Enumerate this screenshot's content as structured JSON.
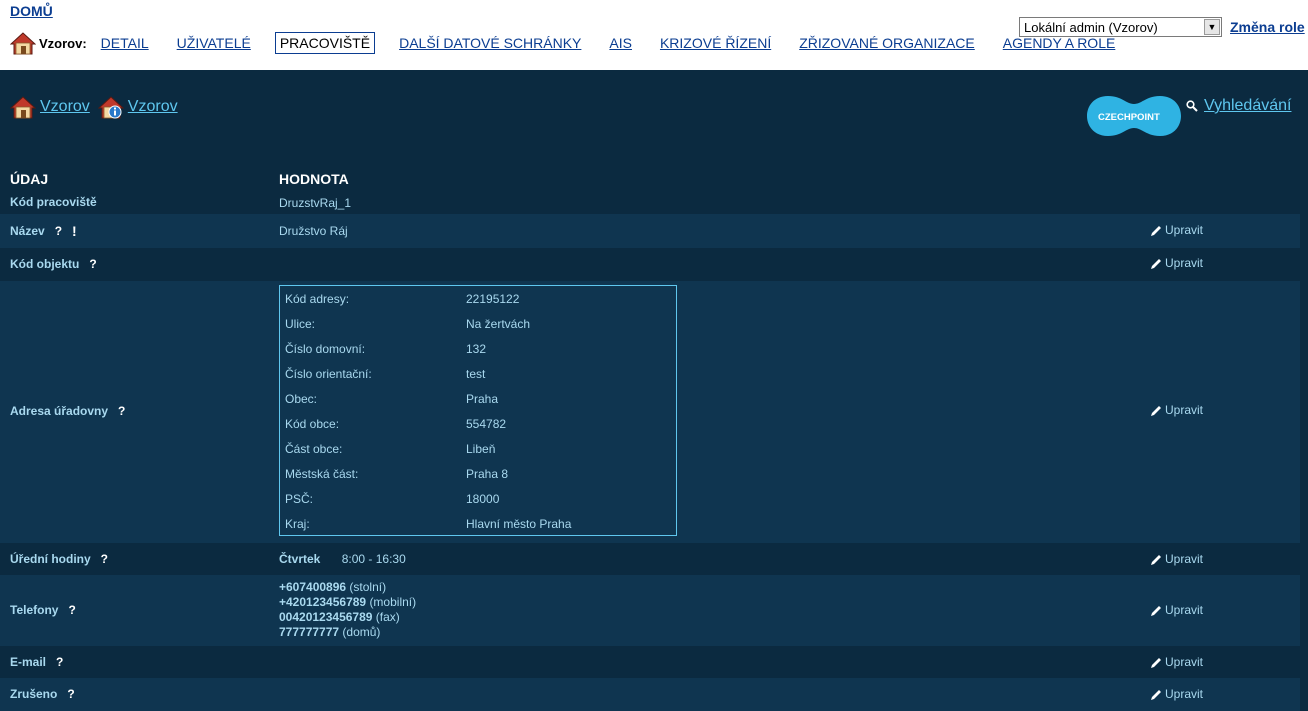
{
  "top": {
    "home_link": "DOMŮ",
    "entity_label": "Vzorov:",
    "nav": [
      "DETAIL",
      "UŽIVATELÉ",
      "PRACOVIŠTĚ",
      "DALŠÍ DATOVÉ SCHRÁNKY",
      "AIS",
      "KRIZOVÉ ŘÍZENÍ",
      "ZŘIZOVANÉ ORGANIZACE",
      "AGENDY A ROLE"
    ],
    "active_nav": "PRACOVIŠTĚ",
    "role_selected": "Lokální admin (Vzorov)",
    "change_role": "Změna role"
  },
  "header": {
    "crumb1": "Vzorov",
    "crumb2": "Vzorov",
    "logo_text": "CZECHPOINT",
    "search_link": "Vyhledávání"
  },
  "table": {
    "col_field": "ÚDAJ",
    "col_value": "HODNOTA",
    "edit_label": "Upravit",
    "help_mark": "?",
    "warn_mark": "!",
    "rows": {
      "kod": {
        "label": "Kód pracoviště",
        "value": "DruzstvRaj_1"
      },
      "nazev": {
        "label": "Název",
        "value": "Družstvo Ráj"
      },
      "kod_objektu": {
        "label": "Kód objektu",
        "value": ""
      },
      "adresa": {
        "label": "Adresa úřadovny"
      },
      "hodiny": {
        "label": "Úřední hodiny",
        "day": "Čtvrtek",
        "time": "8:00 - 16:30"
      },
      "telefony": {
        "label": "Telefony"
      },
      "email": {
        "label": "E-mail"
      },
      "zruseno": {
        "label": "Zrušeno"
      }
    },
    "address": [
      {
        "k": "Kód adresy:",
        "v": "22195122"
      },
      {
        "k": "Ulice:",
        "v": "Na žertvách"
      },
      {
        "k": "Číslo domovní:",
        "v": "132"
      },
      {
        "k": "Číslo orientační:",
        "v": "test"
      },
      {
        "k": "Obec:",
        "v": "Praha"
      },
      {
        "k": "Kód obce:",
        "v": "554782"
      },
      {
        "k": "Část obce:",
        "v": "Libeň"
      },
      {
        "k": "Městská část:",
        "v": "Praha 8"
      },
      {
        "k": "PSČ:",
        "v": "18000"
      },
      {
        "k": "Kraj:",
        "v": "Hlavní město Praha"
      }
    ],
    "phones": [
      {
        "num": "+607400896",
        "type": "(stolní)"
      },
      {
        "num": "+420123456789",
        "type": "(mobilní)"
      },
      {
        "num": "00420123456789",
        "type": "(fax)"
      },
      {
        "num": "777777777",
        "type": "(domů)"
      }
    ]
  },
  "colors": {
    "background": "#0b2a40",
    "row_alt": "#0f3550",
    "link": "#5fc7ef",
    "text": "#a9d9ef",
    "logo": "#2fb3e3"
  }
}
